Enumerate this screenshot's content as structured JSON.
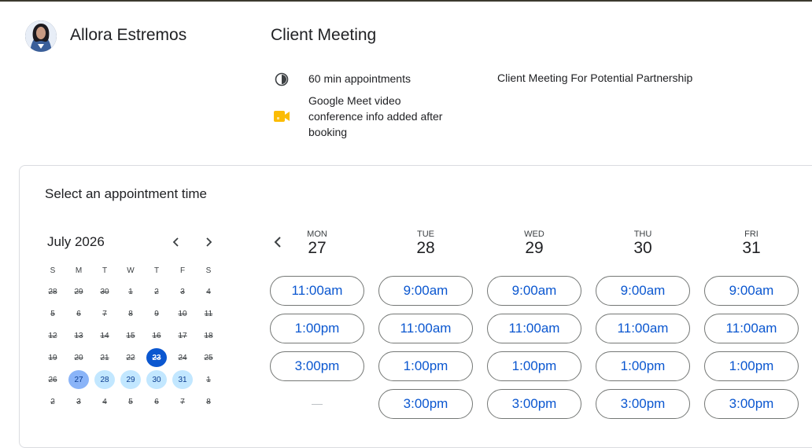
{
  "host": {
    "name": "Allora Estremos"
  },
  "page": {
    "title": "Client Meeting"
  },
  "info": {
    "duration": "60 min appointments",
    "conference_line1": "Google Meet video",
    "conference_line2": "conference info added after",
    "conference_line3": "booking",
    "description": "Client Meeting For Potential Partnership"
  },
  "booking": {
    "heading": "Select an appointment time",
    "calendar": {
      "month_label": "July 2026",
      "weekday_headers": [
        "S",
        "M",
        "T",
        "W",
        "T",
        "F",
        "S"
      ],
      "weeks": [
        [
          "28",
          "29",
          "30",
          "1",
          "2",
          "3",
          "4"
        ],
        [
          "5",
          "6",
          "7",
          "8",
          "9",
          "10",
          "11"
        ],
        [
          "12",
          "13",
          "14",
          "15",
          "16",
          "17",
          "18"
        ],
        [
          "19",
          "20",
          "21",
          "22",
          "23",
          "24",
          "25"
        ],
        [
          "26",
          "27",
          "28",
          "29",
          "30",
          "31",
          "1"
        ],
        [
          "2",
          "3",
          "4",
          "5",
          "6",
          "7",
          "8"
        ]
      ]
    },
    "days": [
      {
        "dow": "MON",
        "date": "27",
        "slots": [
          "11:00am",
          "1:00pm",
          "3:00pm"
        ]
      },
      {
        "dow": "TUE",
        "date": "28",
        "slots": [
          "9:00am",
          "11:00am",
          "1:00pm",
          "3:00pm"
        ]
      },
      {
        "dow": "WED",
        "date": "29",
        "slots": [
          "9:00am",
          "11:00am",
          "1:00pm",
          "3:00pm"
        ]
      },
      {
        "dow": "THU",
        "date": "30",
        "slots": [
          "9:00am",
          "11:00am",
          "1:00pm",
          "3:00pm"
        ]
      },
      {
        "dow": "FRI",
        "date": "31",
        "slots": [
          "9:00am",
          "11:00am",
          "1:00pm",
          "3:00pm"
        ]
      }
    ]
  },
  "colors": {
    "accent": "#0b57d0",
    "available": "#c2e7ff",
    "meet_yellow": "#fbbc04"
  },
  "icons": {
    "duration": "clock-icon",
    "conference": "google-meet-icon",
    "prev": "chevron-left-icon",
    "next": "chevron-right-icon"
  }
}
